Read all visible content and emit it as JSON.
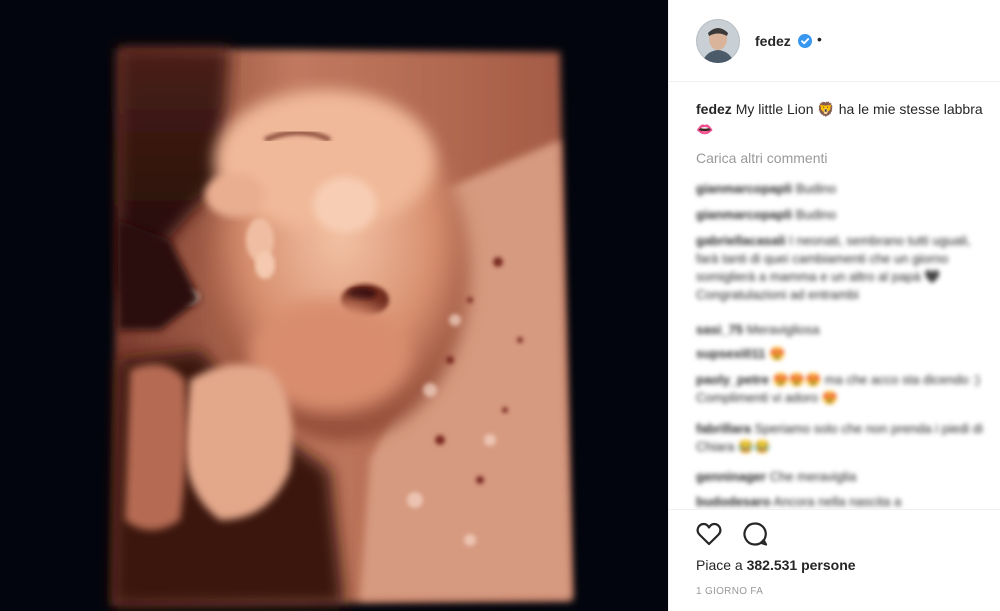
{
  "post": {
    "username": "fedez",
    "header_dot": "•",
    "caption_user": "fedez",
    "caption_text": "My little Lion 🦁 ha le mie stesse labbra 👄",
    "load_more": "Carica altri commenti",
    "likes_prefix": "Piace a",
    "likes_count": "382.531",
    "likes_suffix": "persone",
    "timestamp": "1 GIORNO FA"
  },
  "comments": [
    {
      "user": "gianmarcopapli",
      "text": "Budino"
    },
    {
      "user": "gianmarcopapli",
      "text": "Budino"
    },
    {
      "user": "gabriellacasali",
      "text": "I neonati, sembrano tutti uguali, farà tanti di quei cambiamenti che un giorno somiglierà a mamma e un altro al papà 🖤 Congratulazioni ad entrambi"
    },
    {
      "user": "sasi_75",
      "text": "Meravigliosa"
    },
    {
      "user": "supsexi011",
      "text": "😍"
    },
    {
      "user": "paoly_petre",
      "text": "😍😍😍 ma che acco sta dicendo :) Complimenti vi adoro 😍"
    },
    {
      "user": "fabrillara",
      "text": "Speriamo solo che non prenda i piedi di Chiara 😂😂"
    },
    {
      "user": "genninager",
      "text": "Che meraviglia"
    },
    {
      "user": "budodesaro",
      "text": "Ancora nella nascita a"
    }
  ],
  "colors": {
    "verified_blue": "#3897f0",
    "text_dark": "#262626",
    "text_muted": "#999999"
  },
  "icons": {
    "verified": "verified-badge-icon",
    "like": "heart-icon",
    "comment": "comment-bubble-icon"
  }
}
